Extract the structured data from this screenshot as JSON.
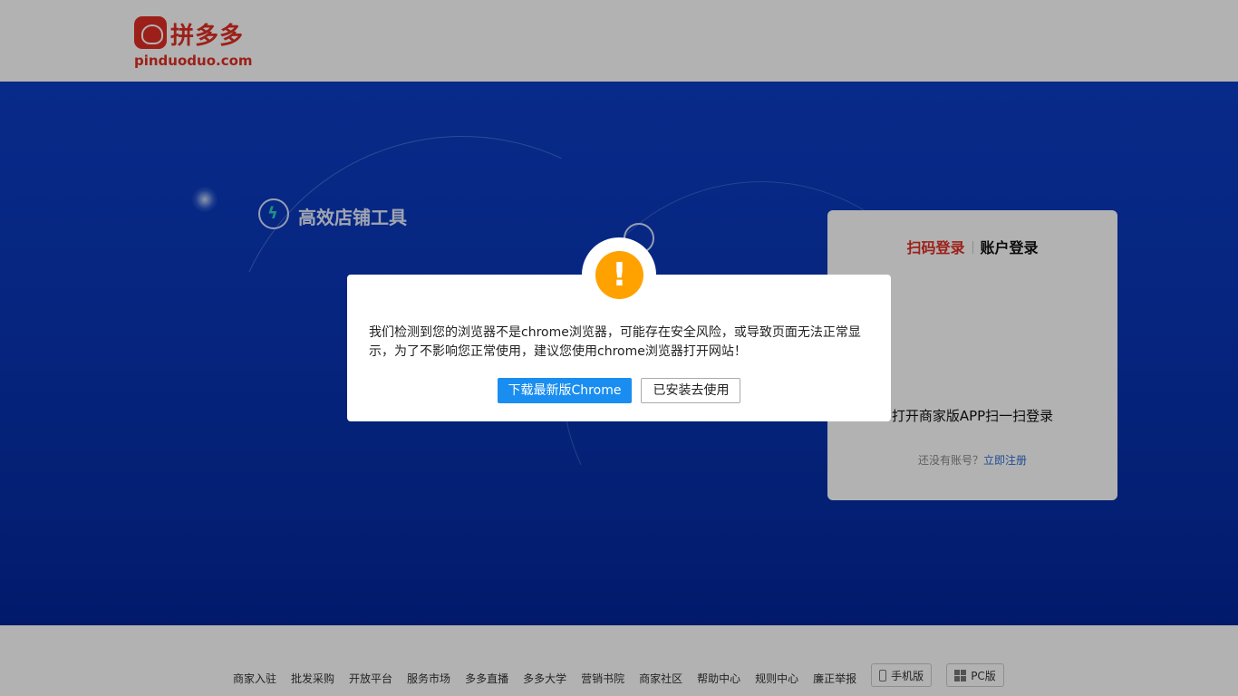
{
  "header": {
    "logo_text": "拼多多",
    "logo_domain": "pinduoduo.com"
  },
  "hero": {
    "feature_label": "高效店铺工具"
  },
  "login": {
    "tab_qr": "扫码登录",
    "tab_account": "账户登录",
    "scan_instruction": "打开商家版APP扫一扫登录",
    "no_account": "还没有账号？",
    "register_link": "立即注册"
  },
  "footer": {
    "links": [
      "商家入驻",
      "批发采购",
      "开放平台",
      "服务市场",
      "多多直播",
      "多多大学",
      "营销书院",
      "商家社区",
      "帮助中心",
      "规则中心",
      "廉正举报"
    ],
    "mobile_btn": "手机版",
    "pc_btn": "PC版"
  },
  "dialog": {
    "icon": "warning-icon",
    "message": "我们检测到您的浏览器不是chrome浏览器，可能存在安全风险，或导致页面无法正常显示，为了不影响您正常使用，建议您使用chrome浏览器打开网站！",
    "download_btn": "下载最新版Chrome",
    "installed_btn": "已安装去使用"
  },
  "colors": {
    "brand_red": "#e02e24",
    "hero_blue": "#0a36b8",
    "warning_orange": "#ffa200",
    "primary_blue": "#1a8ef0"
  }
}
